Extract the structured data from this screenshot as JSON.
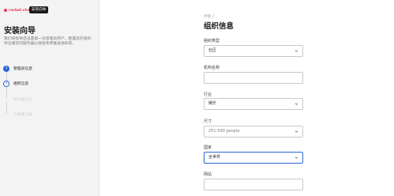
{
  "brand": {
    "logo_text": "rocket.chat",
    "badge": "安装向导"
  },
  "sidebar": {
    "title": "安装向导",
    "description": "我们将指导您设置第一位管理员用户，配置您的组织并注册您的服务器以接收免费推送通知等。",
    "steps": [
      {
        "number": "1",
        "label": "管理员信息",
        "state": "done"
      },
      {
        "number": "2",
        "label": "组织信息",
        "state": "active"
      },
      {
        "number": "3",
        "label": "服务器信息",
        "state": "todo"
      },
      {
        "number": "4",
        "label": "注册服务器",
        "state": "todo"
      }
    ]
  },
  "form": {
    "step_indicator": "步骤 2",
    "title": "组织信息",
    "fields": {
      "org_type": {
        "label": "组织类型",
        "value": "社区"
      },
      "org_name": {
        "label": "机构名称",
        "value": ""
      },
      "industry": {
        "label": "行业",
        "value": "娱乐"
      },
      "size": {
        "label": "尺寸",
        "value": "251-500 people"
      },
      "country": {
        "label": "国家",
        "value": "全世界"
      },
      "website": {
        "label": "网站",
        "value": ""
      }
    }
  },
  "colors": {
    "accent": "#2b65d9",
    "brand": "#e8385a",
    "sidebar_bg": "#f3f3f3"
  }
}
